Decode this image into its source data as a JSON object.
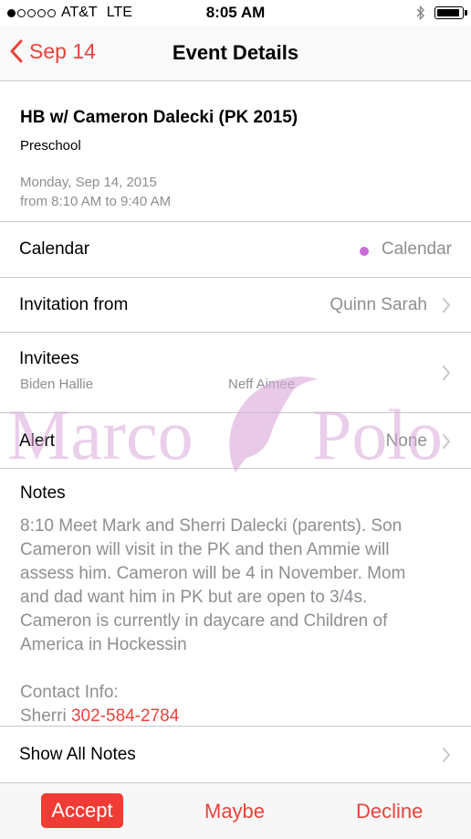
{
  "status_bar": {
    "carrier": "AT&T",
    "network": "LTE",
    "time": "8:05 AM",
    "signal_dots": [
      true,
      false,
      false,
      false,
      false
    ]
  },
  "nav": {
    "back_label": "Sep 14",
    "title": "Event Details"
  },
  "event": {
    "title": "HB w/ Cameron Dalecki (PK 2015)",
    "location": "Preschool",
    "date": "Monday, Sep 14, 2015",
    "time_range": "from 8:10 AM to 9:40 AM"
  },
  "calendar": {
    "label": "Calendar",
    "value": "Calendar",
    "color": "#c86dd7"
  },
  "invitation": {
    "label": "Invitation from",
    "value": "Quinn Sarah"
  },
  "invitees": {
    "label": "Invitees",
    "names": [
      "Biden Hallie",
      "Neff Aimee"
    ]
  },
  "alert": {
    "label": "Alert",
    "value": "None"
  },
  "notes": {
    "label": "Notes",
    "text": "8:10 Meet Mark and Sherri Dalecki (parents). Son Cameron will visit in the PK and then Ammie will assess him. Cameron will be 4 in November. Mom and dad want him in PK but are open to 3/4s. Cameron is currently in daycare and Children of America in Hockessin",
    "contact_label": "Contact Info:",
    "contact_name": "Sherri",
    "contact_phone": "302-584-2784"
  },
  "show_all_notes": {
    "label": "Show All Notes"
  },
  "watermark": {
    "left_word": "Marco",
    "right_word": "Polo"
  },
  "toolbar": {
    "accept": "Accept",
    "maybe": "Maybe",
    "decline": "Decline",
    "accent": "#e8433b"
  }
}
